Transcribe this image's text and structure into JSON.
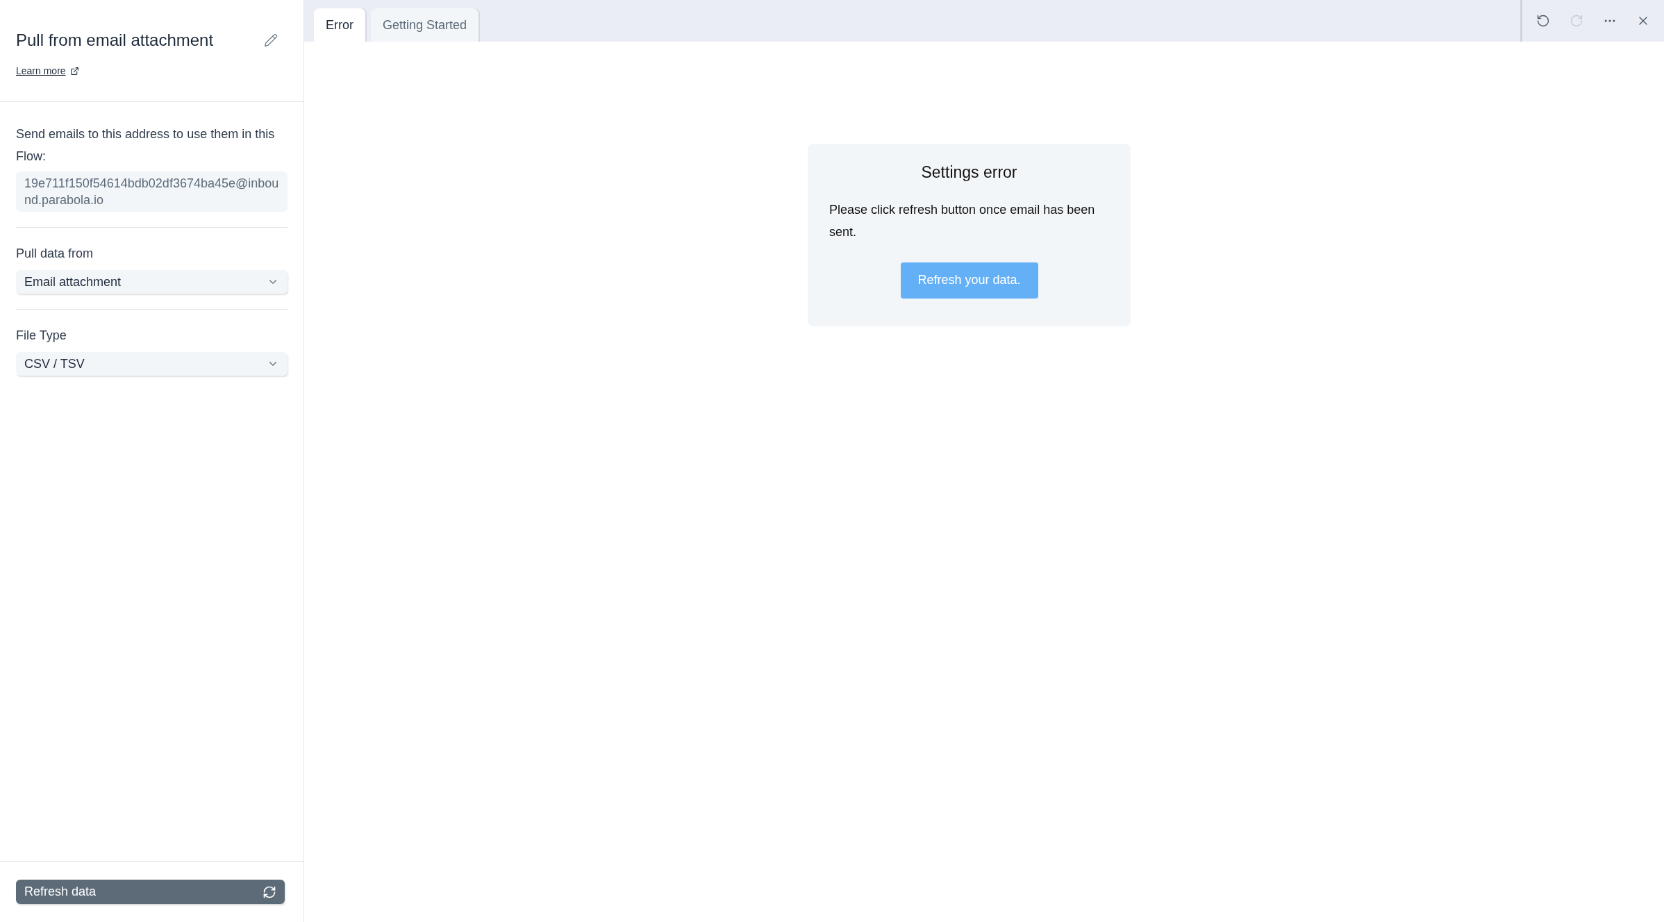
{
  "sidebar": {
    "title": "Pull from email attachment",
    "learn_more": "Learn more",
    "email_section": {
      "label": "Send emails to this address to use them in this Flow:",
      "value": "19e711f150f54614bdb02df3674ba45e@inbound.parabola.io"
    },
    "selects": [
      {
        "label": "Pull data from",
        "value": "Email attachment"
      },
      {
        "label": "File Type",
        "value": "CSV / TSV"
      }
    ],
    "refresh_button": "Refresh data"
  },
  "tabs": [
    {
      "label": "Error",
      "selected": true
    },
    {
      "label": "Getting Started",
      "selected": false
    }
  ],
  "toolbar": [
    {
      "kind": "undo",
      "disabled": false
    },
    {
      "kind": "redo",
      "disabled": true
    },
    {
      "kind": "more",
      "disabled": false
    },
    {
      "kind": "close",
      "disabled": false
    }
  ],
  "error_card": {
    "title": "Settings error",
    "message": "Please click refresh button once email has been sent.",
    "button": "Refresh your data."
  }
}
